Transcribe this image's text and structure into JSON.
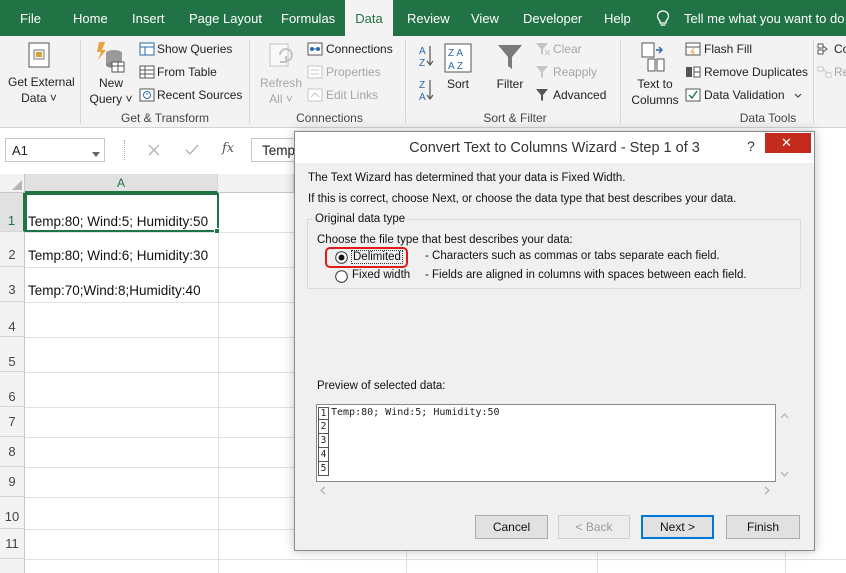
{
  "ribbon_tabs": [
    "File",
    "Home",
    "Insert",
    "Page Layout",
    "Formulas",
    "Data",
    "Review",
    "View",
    "Developer",
    "Help"
  ],
  "active_tab": "Data",
  "tell_me": "Tell me what you want to do",
  "ribbon": {
    "get_external": [
      "Get External",
      "Data ˅"
    ],
    "new_query": [
      "New",
      "Query ˅"
    ],
    "show_queries": "Show Queries",
    "from_table": "From Table",
    "recent_sources": "Recent Sources",
    "refresh_all": [
      "Refresh",
      "All ˅"
    ],
    "connections": "Connections",
    "properties": "Properties",
    "edit_links": "Edit Links",
    "sort": "Sort",
    "filter": "Filter",
    "clear": "Clear",
    "reapply": "Reapply",
    "advanced": "Advanced",
    "text_to_columns": [
      "Text to",
      "Columns"
    ],
    "flash_fill": "Flash Fill",
    "remove_duplicates": "Remove Duplicates",
    "data_validation": "Data Validation",
    "co_partial": "Co",
    "re_partial": "Re",
    "groups": [
      "Get & Transform",
      "Connections",
      "Sort & Filter",
      "Data Tools"
    ]
  },
  "formula_bar": {
    "name_box": "A1",
    "fx": "fx",
    "content": "Temp"
  },
  "sheet": {
    "column": "A",
    "rows": [
      "1",
      "2",
      "3",
      "4",
      "5",
      "6",
      "7",
      "8",
      "9",
      "10",
      "11"
    ],
    "cells": [
      "Temp:80; Wind:5; Humidity:50",
      "Temp:80; Wind:6; Humidity:30",
      "Temp:70;Wind:8;Humidity:40"
    ]
  },
  "dialog": {
    "title": "Convert Text to Columns Wizard - Step 1 of 3",
    "help": "?",
    "close": "✕",
    "line1": "The Text Wizard has determined that your data is Fixed Width.",
    "line2": "If this is correct, choose Next, or choose the data type that best describes your data.",
    "group_title": "Original data type",
    "choose": "Choose the file type that best describes your data:",
    "options": [
      {
        "label": "Delimited",
        "desc": "- Characters such as commas or tabs separate each field.",
        "selected": true
      },
      {
        "label": "Fixed width",
        "desc": "- Fields are aligned in columns with spaces between each field.",
        "selected": false
      }
    ],
    "preview_label": "Preview of selected data:",
    "preview_rows": [
      "1",
      "2",
      "3",
      "4",
      "5"
    ],
    "preview_line": "Temp:80; Wind:5; Humidity:50",
    "buttons": {
      "cancel": "Cancel",
      "back": "< Back",
      "next": "Next >",
      "finish": "Finish"
    }
  },
  "colors": {
    "excel_green": "#217346",
    "highlight_red": "#e01b1b",
    "focus_blue": "#0078d7"
  }
}
